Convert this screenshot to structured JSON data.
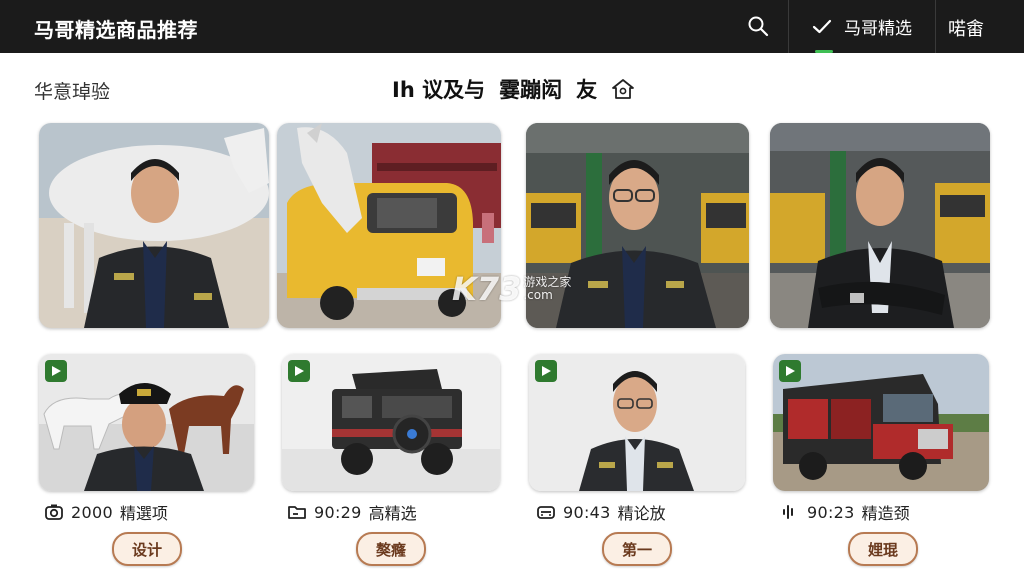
{
  "header": {
    "title": "马哥精选商品推荐",
    "selected_tab": "马哥精选",
    "right_action": "喏畬"
  },
  "section": {
    "left_heading": "华意琸验",
    "center_heading_a": "Ih 议及与",
    "center_heading_b": "霎蹦闳",
    "center_heading_c": "友"
  },
  "cards_top": [
    {
      "name": "man-with-white-horse"
    },
    {
      "name": "horse-with-yellow-bus"
    },
    {
      "name": "man-in-garage-glasses"
    },
    {
      "name": "man-arms-crossed-garage"
    }
  ],
  "cards_bottom": [
    {
      "meta_icon": "camera-icon",
      "meta_value": "2000",
      "meta_label": "精選项",
      "button_label": "设计"
    },
    {
      "meta_icon": "folder-icon",
      "meta_value": "90:29",
      "meta_label": "高精选",
      "button_label": "獒癃"
    },
    {
      "meta_icon": "car-icon",
      "meta_value": "90:43",
      "meta_label": "精论放",
      "button_label": "第一"
    },
    {
      "meta_icon": "audio-icon",
      "meta_value": "90:23",
      "meta_label": "精造颈",
      "button_label": "娌琨"
    }
  ],
  "watermark": {
    "logo": "K73",
    "line1": "游戏之家",
    "line2": ".com"
  },
  "colors": {
    "topbar": "#1b1b1b",
    "accent": "#3fbf54",
    "pill_border": "#b77a52",
    "pill_bg": "#fbefe4"
  }
}
